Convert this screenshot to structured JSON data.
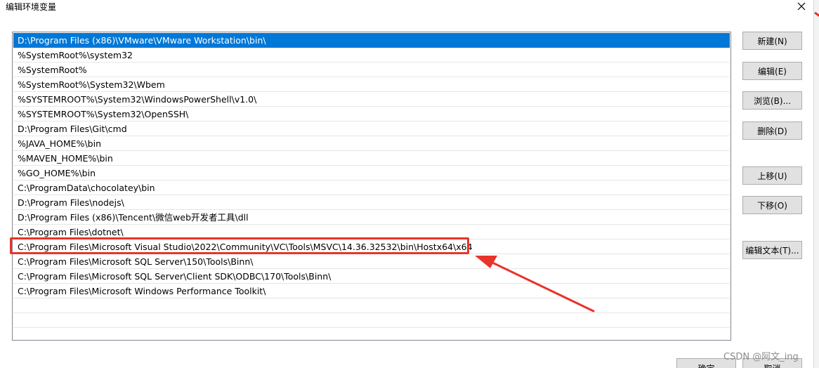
{
  "window": {
    "title": "编辑环境变量",
    "close_label": "×"
  },
  "path_list": {
    "items": [
      "D:\\Program Files (x86)\\VMware\\VMware Workstation\\bin\\",
      "%SystemRoot%\\system32",
      "%SystemRoot%",
      "%SystemRoot%\\System32\\Wbem",
      "%SYSTEMROOT%\\System32\\WindowsPowerShell\\v1.0\\",
      "%SYSTEMROOT%\\System32\\OpenSSH\\",
      "D:\\Program Files\\Git\\cmd",
      "%JAVA_HOME%\\bin",
      "%MAVEN_HOME%\\bin",
      "%GO_HOME%\\bin",
      "C:\\ProgramData\\chocolatey\\bin",
      "D:\\Program Files\\nodejs\\",
      "D:\\Program Files (x86)\\Tencent\\微信web开发者工具\\dll",
      "C:\\Program Files\\dotnet\\",
      "C:\\Program Files\\Microsoft Visual Studio\\2022\\Community\\VC\\Tools\\MSVC\\14.36.32532\\bin\\Hostx64\\x64",
      "C:\\Program Files\\Microsoft SQL Server\\150\\Tools\\Binn\\",
      "C:\\Program Files\\Microsoft SQL Server\\Client SDK\\ODBC\\170\\Tools\\Binn\\",
      "C:\\Program Files\\Microsoft Windows Performance Toolkit\\"
    ],
    "selected_index": 0,
    "highlighted_index": 14
  },
  "buttons": {
    "new": "新建(N)",
    "edit": "编辑(E)",
    "browse": "浏览(B)...",
    "delete": "删除(D)",
    "move_up": "上移(U)",
    "move_down": "下移(O)",
    "edit_text": "编辑文本(T)...",
    "ok": "确定",
    "cancel": "取消"
  },
  "annotation": {
    "color": "#e8342a"
  },
  "watermark": "CSDN @阿文_ing",
  "colors": {
    "selection": "#0078d7",
    "button_face": "#e1e1e1",
    "highlight": "#e8342a"
  }
}
